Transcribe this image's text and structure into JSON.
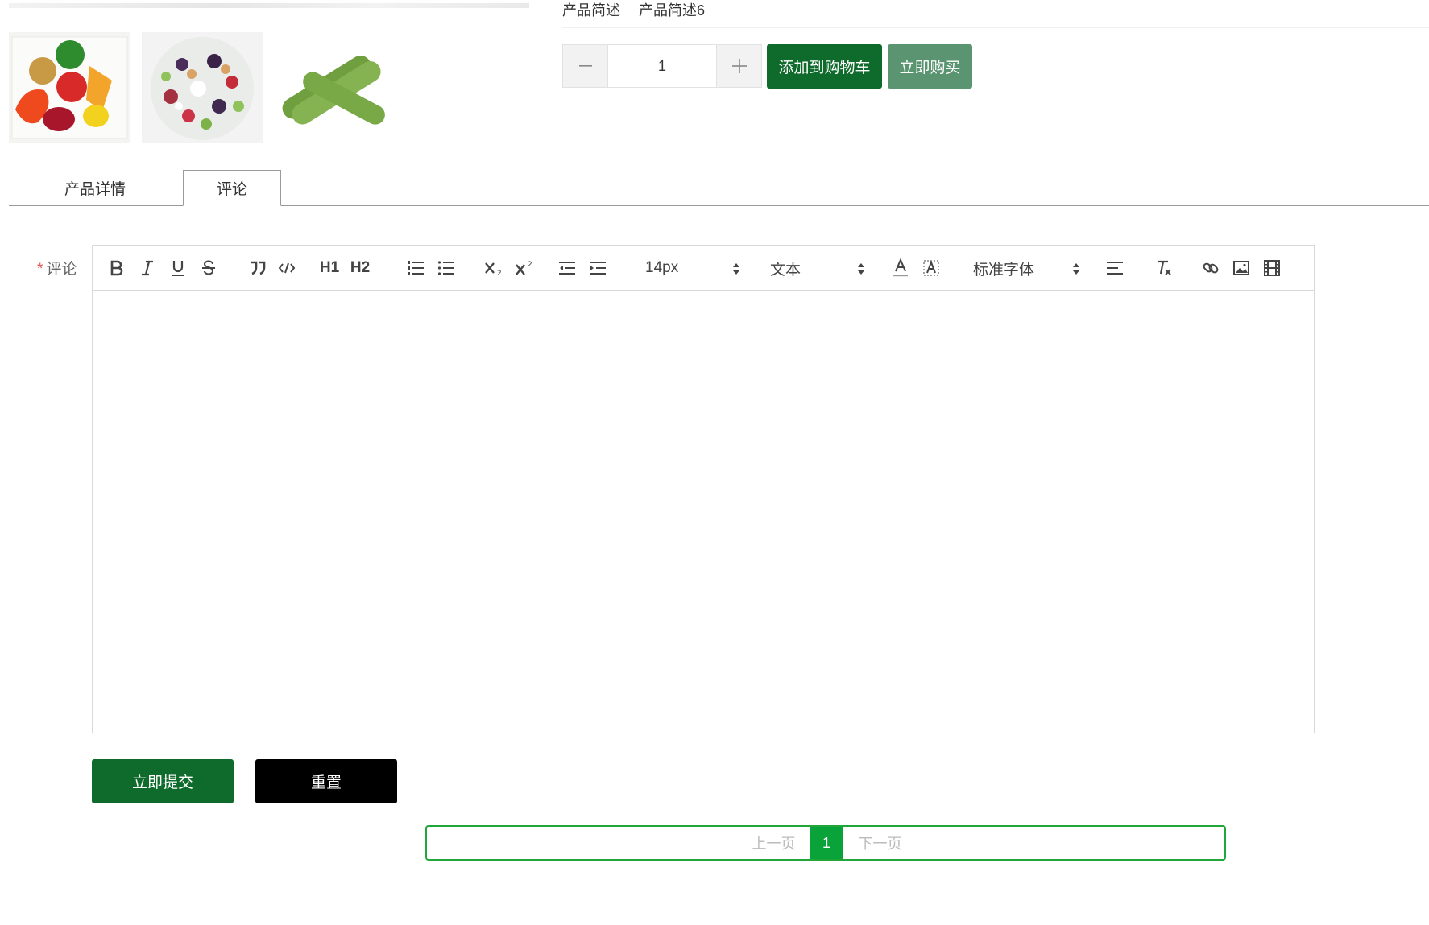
{
  "product": {
    "desc_label": "产品简述",
    "desc_value": "产品简述6",
    "thumbnails": [
      "fruit-plate-image",
      "fruit-salad-image",
      "cucumber-image"
    ]
  },
  "quantity": {
    "value": "1",
    "minus": "−",
    "plus": "+"
  },
  "actions": {
    "add_to_cart": "添加到购物车",
    "buy_now": "立即购买"
  },
  "tabs": [
    {
      "label": "产品详情",
      "active": false
    },
    {
      "label": "评论",
      "active": true
    }
  ],
  "comment": {
    "required_mark": "*",
    "label": "评论",
    "toolbar": {
      "font_size": "14px",
      "header_select": "文本",
      "font_family": "标准字体",
      "h1": "H1",
      "h2": "H2"
    }
  },
  "form": {
    "submit": "立即提交",
    "reset": "重置"
  },
  "pagination": {
    "prev": "上一页",
    "current": "1",
    "next": "下一页"
  },
  "colors": {
    "primary_green": "#0f6b2c",
    "buy_green": "#5a9470",
    "pager_green": "#22a63a"
  }
}
